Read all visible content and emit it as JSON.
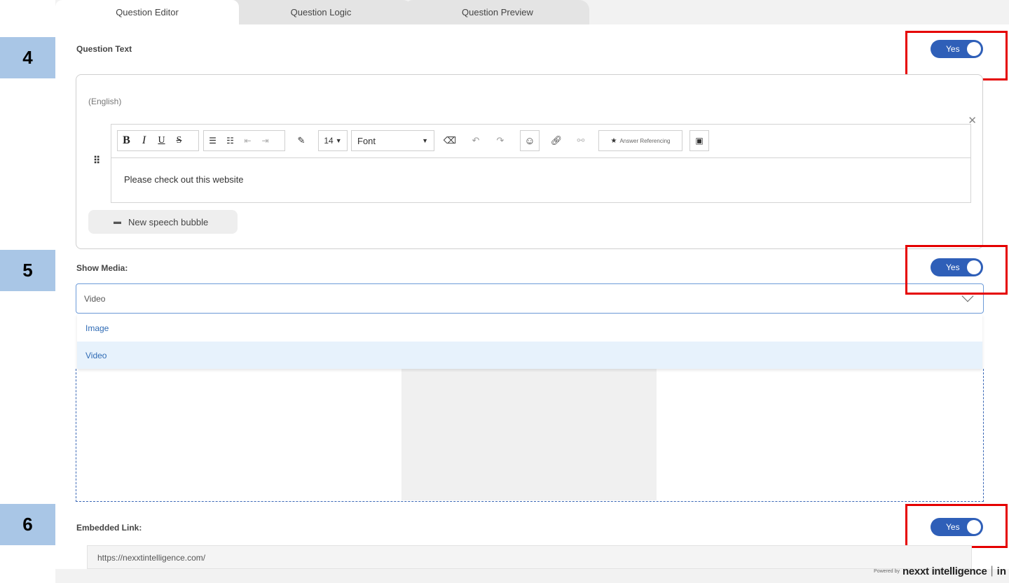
{
  "tabs": [
    {
      "label": "Question Editor"
    },
    {
      "label": "Question Logic"
    },
    {
      "label": "Question Preview"
    }
  ],
  "steps": [
    "4",
    "5",
    "6"
  ],
  "question_text": {
    "label": "Question Text",
    "toggle_label": "Yes",
    "language": "(English)",
    "content": "Please check out this website",
    "font_size": "14",
    "font_name": "Font",
    "answer_referencing": "Answer Referencing",
    "new_bubble_label": "New speech bubble"
  },
  "show_media": {
    "label": "Show Media:",
    "toggle_label": "Yes",
    "selected": "Video",
    "options": [
      "Image",
      "Video"
    ]
  },
  "embedded_link": {
    "label": "Embedded Link:",
    "toggle_label": "Yes",
    "url": "https://nexxtintelligence.com/"
  },
  "footer": {
    "powered_by": "Powered by",
    "brand": "nexxt intelligence",
    "brand_suffix": "in"
  },
  "colors": {
    "toggle": "#2f5fb8",
    "highlight": "#e50000",
    "badge": "#a9c6e6",
    "menu_selected": "#e7f2fc"
  }
}
